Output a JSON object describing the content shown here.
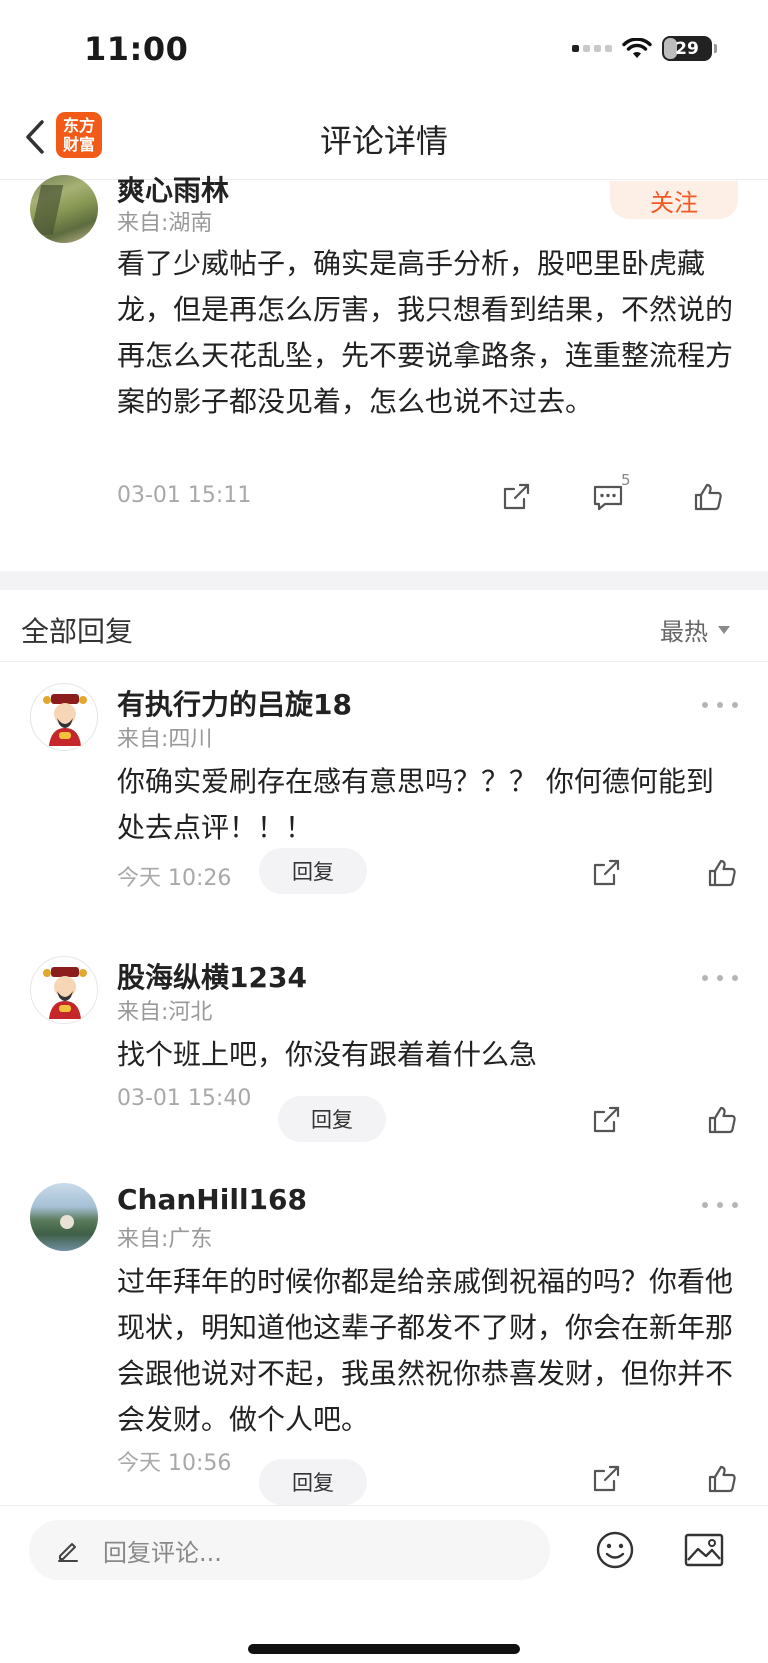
{
  "status": {
    "time": "11:00",
    "battery": "29",
    "battery_level": 0.29
  },
  "nav": {
    "title": "评论详情",
    "logo_line1": "东方",
    "logo_line2": "财富"
  },
  "main_comment": {
    "user": "爽心雨林",
    "location": "来自:湖南",
    "follow_label": "关注",
    "text": "看了少威帖子，确实是高手分析，股吧里卧虎藏龙，但是再怎么厉害，我只想看到结果，不然说的再怎么天花乱坠，先不要说拿路条，连重整流程方案的影子都没见着，怎么也说不过去。",
    "time": "03-01 15:11",
    "reply_count": "5"
  },
  "replies_section": {
    "title": "全部回复",
    "sort_label": "最热"
  },
  "replies": [
    {
      "user": "有执行力的吕旋18",
      "location": "来自:四川",
      "text": "你确实爱刷存在感有意思吗？？？ 你何德何能到处去点评！！！",
      "time": "今天 10:26",
      "reply_label": "回复",
      "avatar": "fortune-god"
    },
    {
      "user": "股海纵横1234",
      "location": "来自:河北",
      "text": "找个班上吧，你没有跟着着什么急",
      "time": "03-01 15:40",
      "reply_label": "回复",
      "avatar": "fortune-god"
    },
    {
      "user": "ChanHill168",
      "location": "来自:广东",
      "text": "过年拜年的时候你都是给亲戚倒祝福的吗？你看他现状，明知道他这辈子都发不了财，你会在新年那会跟他说对不起，我虽然祝你恭喜发财，但你并不会发财。做个人吧。",
      "time": "今天 10:56",
      "reply_label": "回复",
      "avatar": "landscape"
    }
  ],
  "bottom": {
    "input_placeholder": "回复评论..."
  },
  "colors": {
    "accent": "#f15a22",
    "logo": "#f25a17",
    "follow_bg": "#fdeee6",
    "muted": "#999999"
  },
  "icons": [
    "back-arrow-icon",
    "share-icon",
    "comment-icon",
    "like-icon",
    "more-icon",
    "pen-icon",
    "emoji-icon",
    "image-icon"
  ]
}
